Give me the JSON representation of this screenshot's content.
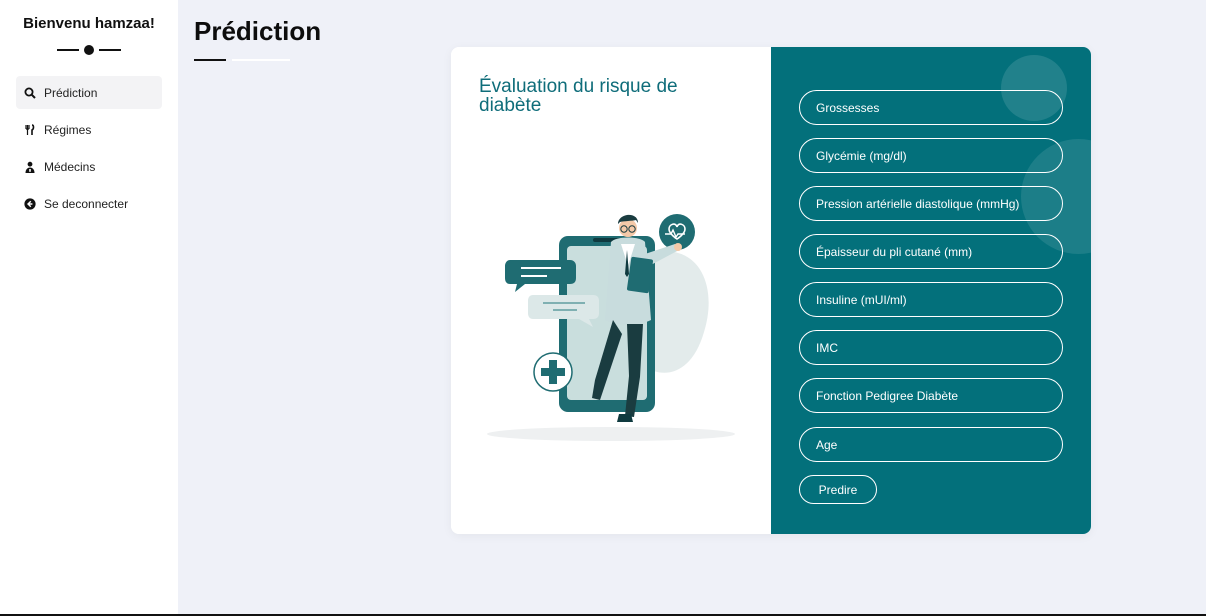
{
  "sidebar": {
    "welcome": "Bienvenu hamzaa!",
    "items": [
      {
        "label": "Prédiction",
        "icon": "search-icon"
      },
      {
        "label": "Régimes",
        "icon": "utensils-icon"
      },
      {
        "label": "Médecins",
        "icon": "doctor-icon"
      },
      {
        "label": "Se deconnecter",
        "icon": "logout-icon"
      }
    ],
    "active_index": 0
  },
  "header": {
    "title": "Prédiction"
  },
  "card": {
    "title": "Évaluation du risque de diabète",
    "illustration": "doctor-with-phone-illustration",
    "fields": [
      "Grossesses",
      "Glycémie (mg/dl)",
      "Pression artérielle diastolique (mmHg)",
      "Épaisseur du pli cutané (mm)",
      "Insuline (mUI/ml)",
      "IMC",
      "Fonction Pedigree Diabète",
      "Age"
    ],
    "submit_label": "Predire"
  },
  "colors": {
    "accent": "#03707b",
    "title_teal": "#0f6d7a",
    "background": "#eff1f8"
  }
}
